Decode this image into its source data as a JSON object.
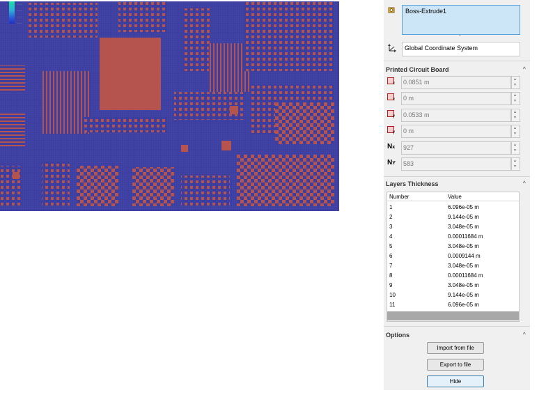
{
  "pcb_view": {
    "colors": {
      "dielectric": "#3c3ea0",
      "copper": "#b5544f"
    },
    "legend_labels": [
      "·····",
      "·····",
      "·····",
      "·····"
    ]
  },
  "panel": {
    "selection": {
      "value": "Boss-Extrude1",
      "icon": "feature-icon"
    },
    "coordinate_system": {
      "value": "Global Coordinate System",
      "icon": "coordinate-axes-icon"
    },
    "pcb_section": {
      "title": "Printed Circuit Board",
      "fields": [
        {
          "icon": "length-x-icon",
          "sub": "x",
          "value": "0.0851 m"
        },
        {
          "icon": "offset-x-icon",
          "sub": "x",
          "value": "0 m"
        },
        {
          "icon": "length-y-icon",
          "sub": "y",
          "value": "0.0533 m"
        },
        {
          "icon": "offset-y-icon",
          "sub": "y",
          "value": "0 m"
        }
      ],
      "nx": {
        "label": "N",
        "sub": "x",
        "value": "927"
      },
      "ny": {
        "label": "N",
        "sub": "Y",
        "value": "583"
      }
    },
    "layers_section": {
      "title": "Layers Thickness",
      "columns": [
        "Number",
        "Value"
      ],
      "rows": [
        [
          "1",
          "6.096e-05 m"
        ],
        [
          "2",
          "9.144e-05 m"
        ],
        [
          "3",
          "3.048e-05 m"
        ],
        [
          "4",
          "0.00011684 m"
        ],
        [
          "5",
          "3.048e-05 m"
        ],
        [
          "6",
          "0.0009144 m"
        ],
        [
          "7",
          "3.048e-05 m"
        ],
        [
          "8",
          "0.00011684 m"
        ],
        [
          "9",
          "3.048e-05 m"
        ],
        [
          "10",
          "9.144e-05 m"
        ],
        [
          "11",
          "6.096e-05 m"
        ]
      ]
    },
    "options_section": {
      "title": "Options",
      "import_label": "Import from file",
      "export_label": "Export to file",
      "hide_label": "Hide"
    },
    "collapse_glyph": "^",
    "spin_up": "▲",
    "spin_down": "▼"
  }
}
